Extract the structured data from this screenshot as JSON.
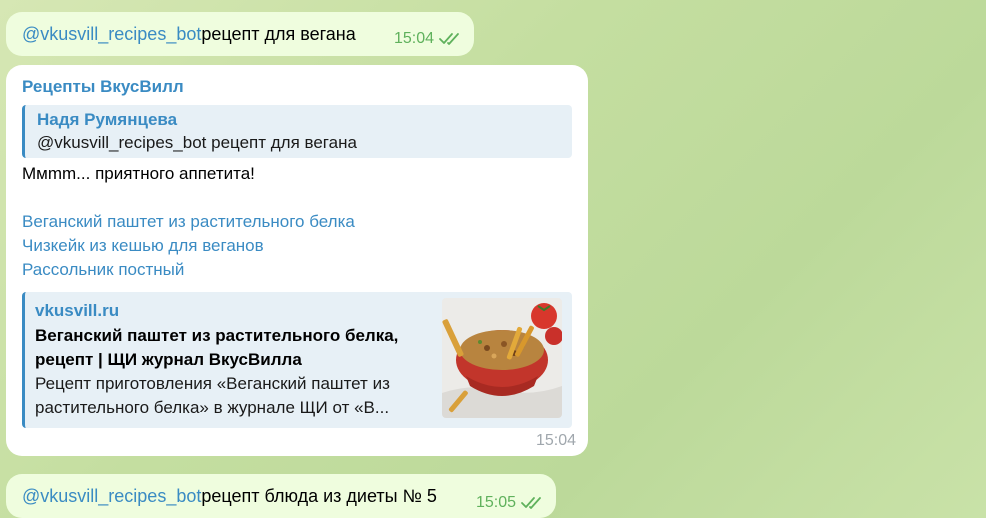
{
  "messages": {
    "m1": {
      "mention": "@vkusvill_recipes_bot",
      "text": " рецепт для вегана",
      "time": "15:04"
    },
    "m2": {
      "sender": "Рецепты ВкусВилл",
      "reply": {
        "name": "Надя Румянцева",
        "text": "@vkusvill_recipes_bot рецепт для вегана"
      },
      "greeting": "Ммmm... приятного аппетита!",
      "links": [
        "Веганский паштет из растительного белка",
        "Чизкейк из кешью для веганов",
        "Рассольник постный"
      ],
      "preview": {
        "site": "vkusvill.ru",
        "title": "Веганский паштет из растительного белка, рецепт | ЩИ журнал ВкусВилла",
        "description": "Рецепт приготовления «Веганский паштет из растительного белка» в журнале ЩИ от «В..."
      },
      "time": "15:04"
    },
    "m3": {
      "mention": "@vkusvill_recipes_bot",
      "text": " рецепт блюда из диеты № 5",
      "time": "15:05"
    }
  },
  "colors": {
    "accent": "#3a8bc3",
    "outgoing_bg": "#effdde",
    "read_check": "#5fb15c"
  },
  "icons": {
    "read": "double-check-icon"
  }
}
